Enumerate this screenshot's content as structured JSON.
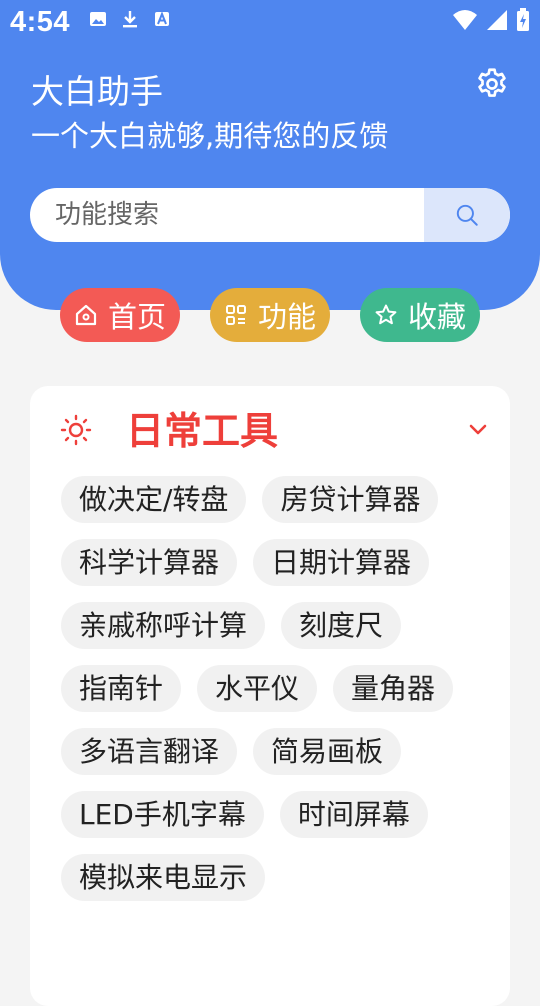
{
  "status_bar": {
    "time": "4:54",
    "left_icons": [
      "image-icon",
      "download-icon",
      "a-badge-icon"
    ],
    "right_icons": [
      "wifi-icon",
      "signal-icon",
      "battery-icon"
    ]
  },
  "header": {
    "title": "大白助手",
    "subtitle": "一个大白就够,期待您的反馈",
    "settings_icon": "gear-icon",
    "background": "#4f86ef"
  },
  "search": {
    "placeholder": "功能搜索",
    "value": "",
    "button_icon": "search-icon"
  },
  "tabs": [
    {
      "label": "首页",
      "icon": "home-icon",
      "color": "#f35a55"
    },
    {
      "label": "功能",
      "icon": "grid-icon",
      "color": "#e4ad3b"
    },
    {
      "label": "收藏",
      "icon": "star-icon",
      "color": "#3fb88e"
    }
  ],
  "section": {
    "title": "日常工具",
    "title_color": "#ee3f3a",
    "icon": "sun-icon",
    "expanded": true,
    "items": [
      "做决定/转盘",
      "房贷计算器",
      "科学计算器",
      "日期计算器",
      "亲戚称呼计算",
      "刻度尺",
      "指南针",
      "水平仪",
      "量角器",
      "多语言翻译",
      "简易画板",
      "LED手机字幕",
      "时间屏幕",
      "模拟来电显示"
    ]
  }
}
